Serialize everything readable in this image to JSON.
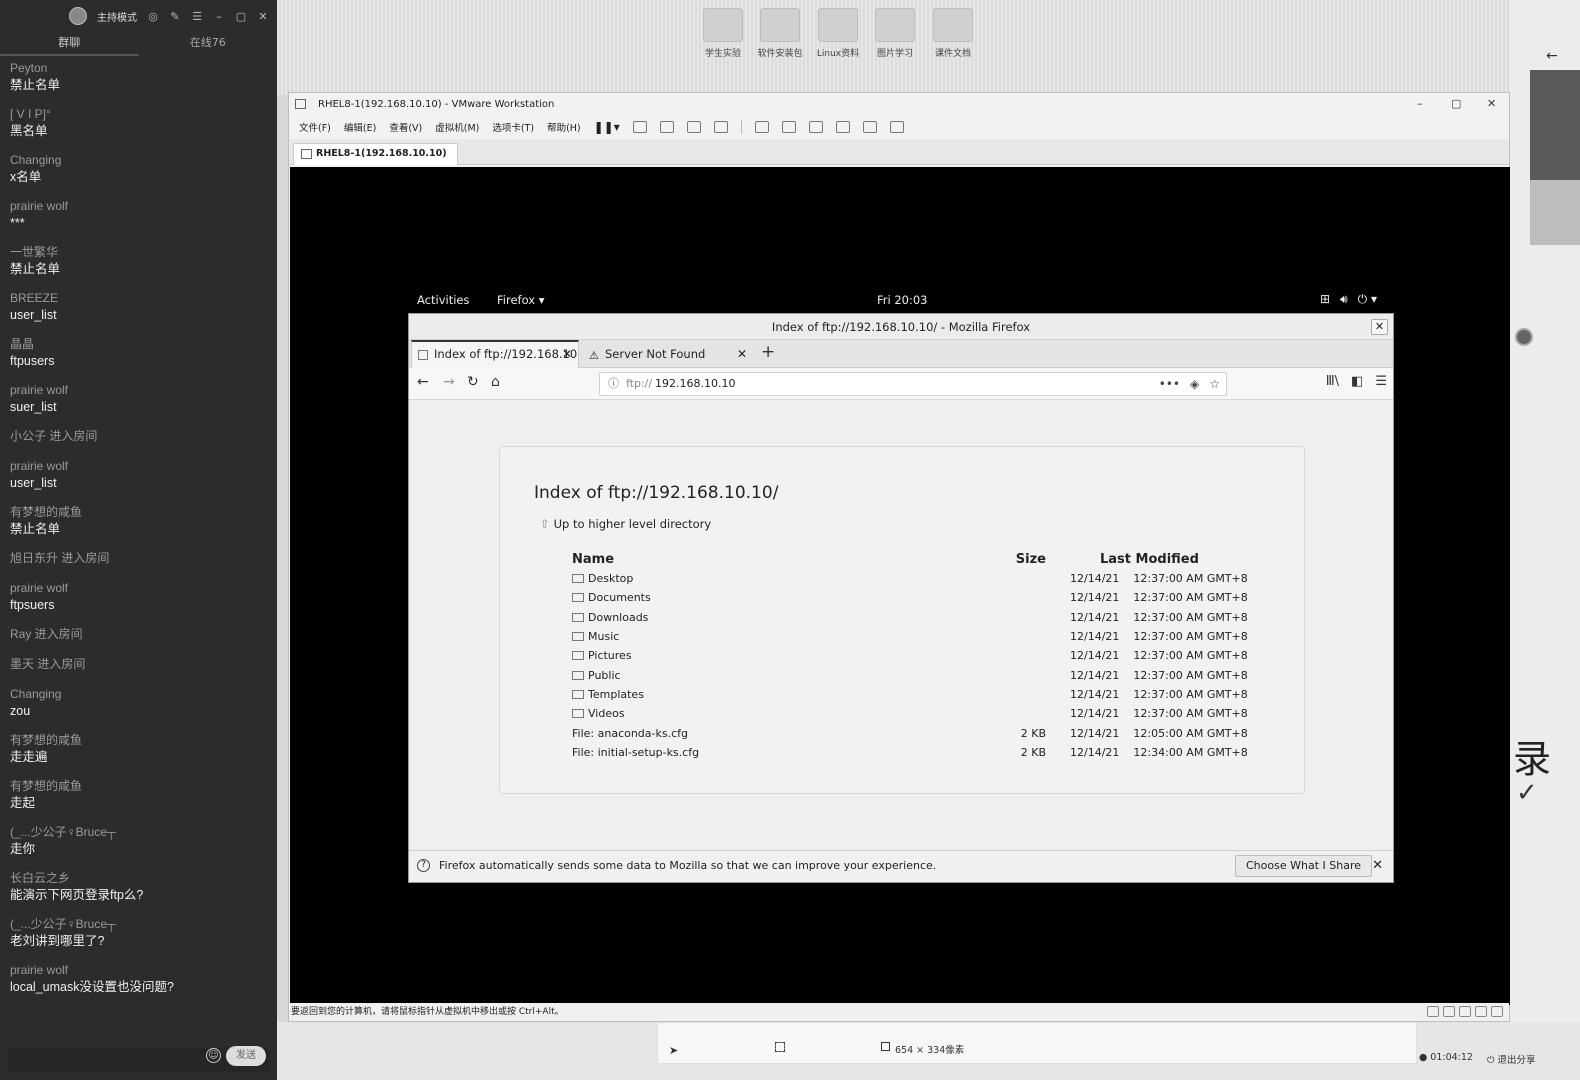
{
  "chat": {
    "title": "主持模式",
    "tabs": [
      "群聊",
      "在线76"
    ],
    "messages": [
      {
        "name": "Peyton",
        "text": "禁止名单"
      },
      {
        "name": "[ V I P]°",
        "text": "黑名单"
      },
      {
        "name": "Changing",
        "text": "x名单"
      },
      {
        "name": "prairie wolf",
        "text": "***"
      },
      {
        "name": "一世繁华",
        "text": "禁止名单"
      },
      {
        "name": "BREEZE",
        "text": "user_list"
      },
      {
        "name": "晶晶",
        "text": "ftpusers"
      },
      {
        "name": "prairie wolf",
        "text": "suer_list"
      },
      {
        "name": "小公子 进入房间",
        "text": ""
      },
      {
        "name": "prairie wolf",
        "text": "user_list"
      },
      {
        "name": "有梦想的咸鱼",
        "text": "禁止名单"
      },
      {
        "name": "旭日东升 进入房间",
        "text": ""
      },
      {
        "name": "prairie wolf",
        "text": "ftpsuers"
      },
      {
        "name": "Ray 进入房间",
        "text": ""
      },
      {
        "name": "墨天 进入房间",
        "text": ""
      },
      {
        "name": "Changing",
        "text": "zou"
      },
      {
        "name": "有梦想的咸鱼",
        "text": "走走遍"
      },
      {
        "name": "有梦想的咸鱼",
        "text": "走起"
      },
      {
        "name": "(_...少公子♀Bruce┬",
        "text": "走你"
      },
      {
        "name": "长白云之乡",
        "text": "能演示下网页登录ftp么?"
      },
      {
        "name": "(_...少公子♀Bruce┬",
        "text": "老刘讲到哪里了?"
      },
      {
        "name": "prairie wolf",
        "text": "local_umask没设置也没问题?"
      }
    ],
    "send_label": "发送"
  },
  "desktop": {
    "icons": [
      "学生实验",
      "软件安装包",
      "Linux资料",
      "图片学习",
      "课件文档"
    ]
  },
  "vmware": {
    "title": "RHEL8-1(192.168.10.10) - VMware Workstation",
    "menu": [
      "文件(F)",
      "编辑(E)",
      "查看(V)",
      "虚拟机(M)",
      "选项卡(T)",
      "帮助(H)"
    ],
    "tab_label": "RHEL8-1(192.168.10.10)",
    "status_text": "要返回到您的计算机，请将鼠标指针从虚拟机中移出或按 Ctrl+Alt。",
    "window_controls": [
      "–",
      "▢",
      "✕"
    ]
  },
  "gnome": {
    "activities": "Activities",
    "app": "Firefox ▾",
    "clock": "Fri 20:03",
    "sys_icons": [
      "network-icon",
      "volume-icon",
      "power-icon"
    ]
  },
  "firefox": {
    "window_title": "Index of ftp://192.168.10.10/ - Mozilla Firefox",
    "tabs": [
      {
        "label": "Index of ftp://192.168.10",
        "active": true
      },
      {
        "label": "Server Not Found",
        "active": false
      }
    ],
    "url_scheme": "ftp://",
    "url_host": "192.168.10.10",
    "notice_text": "Firefox automatically sends some data to Mozilla so that we can improve your experience.",
    "notice_button": "Choose What I Share"
  },
  "ftp": {
    "title": "Index of ftp://192.168.10.10/",
    "up_link": "Up to higher level directory",
    "headers": {
      "name": "Name",
      "size": "Size",
      "modified": "Last Modified"
    },
    "rows": [
      {
        "name": "Desktop",
        "size": "",
        "date": "12/14/21",
        "time": "12:37:00 AM GMT+8",
        "folder": true
      },
      {
        "name": "Documents",
        "size": "",
        "date": "12/14/21",
        "time": "12:37:00 AM GMT+8",
        "folder": true
      },
      {
        "name": "Downloads",
        "size": "",
        "date": "12/14/21",
        "time": "12:37:00 AM GMT+8",
        "folder": true
      },
      {
        "name": "Music",
        "size": "",
        "date": "12/14/21",
        "time": "12:37:00 AM GMT+8",
        "folder": true
      },
      {
        "name": "Pictures",
        "size": "",
        "date": "12/14/21",
        "time": "12:37:00 AM GMT+8",
        "folder": true
      },
      {
        "name": "Public",
        "size": "",
        "date": "12/14/21",
        "time": "12:37:00 AM GMT+8",
        "folder": true
      },
      {
        "name": "Templates",
        "size": "",
        "date": "12/14/21",
        "time": "12:37:00 AM GMT+8",
        "folder": true
      },
      {
        "name": "Videos",
        "size": "",
        "date": "12/14/21",
        "time": "12:37:00 AM GMT+8",
        "folder": true
      },
      {
        "name": "File: anaconda-ks.cfg",
        "size": "2 KB",
        "date": "12/14/21",
        "time": "12:05:00 AM GMT+8",
        "folder": false
      },
      {
        "name": "File: initial-setup-ks.cfg",
        "size": "2 KB",
        "date": "12/14/21",
        "time": "12:34:00 AM GMT+8",
        "folder": false
      }
    ]
  },
  "bottom": {
    "size_text": "654 × 334像素",
    "timer": "● 01:04:12",
    "exit": "⏻ 退出分享"
  },
  "right_strip": {
    "big_char": "录"
  }
}
